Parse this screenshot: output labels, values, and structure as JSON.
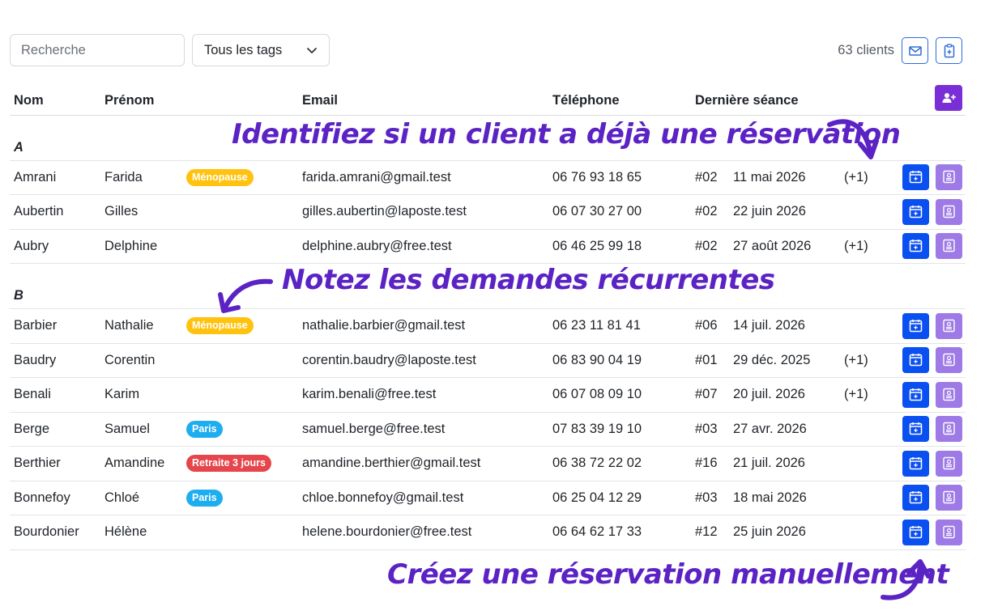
{
  "toolbar": {
    "search_placeholder": "Recherche",
    "tag_filter": "Tous les tags",
    "client_count": "63 clients"
  },
  "columns": [
    "Nom",
    "Prénom",
    "",
    "Email",
    "Téléphone",
    "Dernière séance",
    "",
    ""
  ],
  "groups": [
    {
      "letter": "A",
      "rows": [
        {
          "nom": "Amrani",
          "prenom": "Farida",
          "tag": "Ménopause",
          "tag_color": "#ffc20e",
          "email": "farida.amrani@gmail.test",
          "tel": "06 76 93 18 65",
          "num": "#02",
          "date": "11 mai 2026",
          "extra": "(+1)"
        },
        {
          "nom": "Aubertin",
          "prenom": "Gilles",
          "tag": "",
          "tag_color": "",
          "email": "gilles.aubertin@laposte.test",
          "tel": "06 07 30 27 00",
          "num": "#02",
          "date": "22 juin 2026",
          "extra": ""
        },
        {
          "nom": "Aubry",
          "prenom": "Delphine",
          "tag": "",
          "tag_color": "",
          "email": "delphine.aubry@free.test",
          "tel": "06 46 25 99 18",
          "num": "#02",
          "date": "27 août 2026",
          "extra": "(+1)"
        }
      ]
    },
    {
      "letter": "B",
      "rows": [
        {
          "nom": "Barbier",
          "prenom": "Nathalie",
          "tag": "Ménopause",
          "tag_color": "#ffc20e",
          "email": "nathalie.barbier@gmail.test",
          "tel": "06 23 11 81 41",
          "num": "#06",
          "date": "14 juil. 2026",
          "extra": ""
        },
        {
          "nom": "Baudry",
          "prenom": "Corentin",
          "tag": "",
          "tag_color": "",
          "email": "corentin.baudry@laposte.test",
          "tel": "06 83 90 04 19",
          "num": "#01",
          "date": "29 déc. 2025",
          "extra": "(+1)"
        },
        {
          "nom": "Benali",
          "prenom": "Karim",
          "tag": "",
          "tag_color": "",
          "email": "karim.benali@free.test",
          "tel": "06 07 08 09 10",
          "num": "#07",
          "date": "20 juil. 2026",
          "extra": "(+1)"
        },
        {
          "nom": "Berge",
          "prenom": "Samuel",
          "tag": "Paris",
          "tag_color": "#1eaef0",
          "email": "samuel.berge@free.test",
          "tel": "07 83 39 19 10",
          "num": "#03",
          "date": "27 avr. 2026",
          "extra": ""
        },
        {
          "nom": "Berthier",
          "prenom": "Amandine",
          "tag": "Retraite 3 jours",
          "tag_color": "#e5454b",
          "email": "amandine.berthier@gmail.test",
          "tel": "06 38 72 22 02",
          "num": "#16",
          "date": "21 juil. 2026",
          "extra": ""
        },
        {
          "nom": "Bonnefoy",
          "prenom": "Chloé",
          "tag": "Paris",
          "tag_color": "#1eaef0",
          "email": "chloe.bonnefoy@gmail.test",
          "tel": "06 25 04 12 29",
          "num": "#03",
          "date": "18 mai 2026",
          "extra": ""
        },
        {
          "nom": "Bourdonier",
          "prenom": "Hélène",
          "tag": "",
          "tag_color": "",
          "email": "helene.bourdonier@free.test",
          "tel": "06 64 62 17 33",
          "num": "#12",
          "date": "25 juin 2026",
          "extra": ""
        }
      ]
    }
  ],
  "annotations": {
    "reservation_hint": "Identifiez si un client a déjà une réservation",
    "recurring_hint": "Notez les demandes récurrentes",
    "manual_hint": "Créez une réservation manuellement"
  },
  "icons": {
    "mail": "envelope-icon",
    "export": "clipboard-icon",
    "add_client": "add-user-icon",
    "calendar": "calendar-icon",
    "contact": "contact-card-icon"
  },
  "colors": {
    "primary_blue": "#0a4ff0",
    "secondary_purple": "#9d7ae6",
    "add_purple": "#7a2fd6",
    "annotation": "#5b22c4"
  }
}
